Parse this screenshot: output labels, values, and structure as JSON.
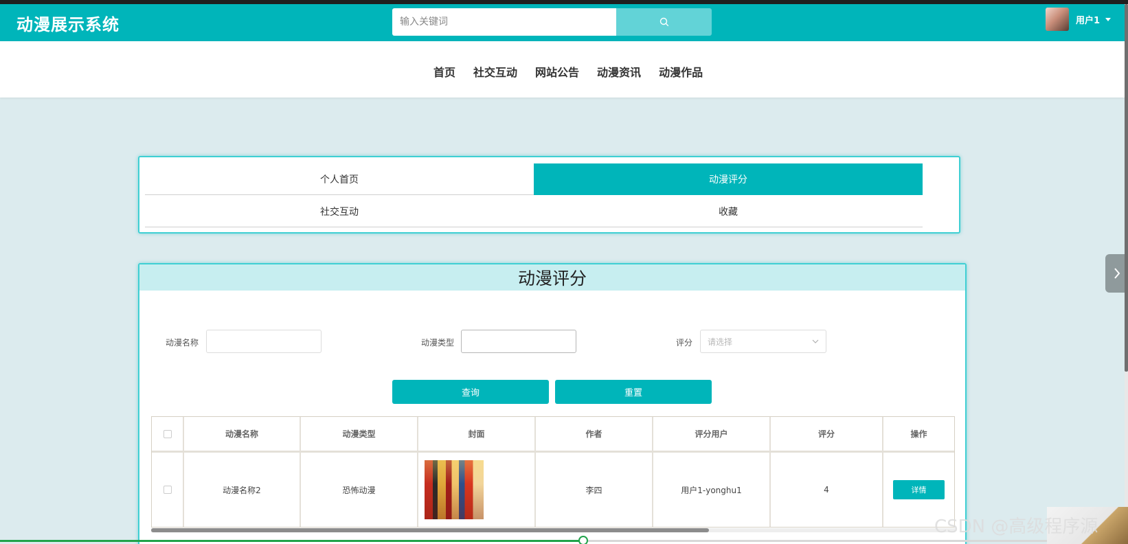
{
  "app": {
    "title": "动漫展示系统",
    "search_placeholder": "输入关键词",
    "username": "用户1"
  },
  "nav": {
    "items": [
      "首页",
      "社交互动",
      "网站公告",
      "动漫资讯",
      "动漫作品"
    ]
  },
  "tabs": {
    "items": [
      "个人首页",
      "动漫评分",
      "社交互动",
      "收藏"
    ],
    "active": "动漫评分"
  },
  "panel": {
    "title": "动漫评分",
    "filters": {
      "name_label": "动漫名称",
      "name_value": "",
      "type_label": "动漫类型",
      "type_value": "",
      "score_label": "评分",
      "score_placeholder": "请选择"
    },
    "buttons": {
      "query": "查询",
      "reset": "重置"
    }
  },
  "table": {
    "columns": [
      "动漫名称",
      "动漫类型",
      "封面",
      "作者",
      "评分用户",
      "评分",
      "操作"
    ],
    "rows": [
      {
        "name": "动漫名称2",
        "type": "恐怖动漫",
        "author": "李四",
        "rating_user": "用户1-yonghu1",
        "score": "4",
        "action": "详情"
      }
    ]
  },
  "watermark": "CSDN @高级程序源",
  "icons": {
    "search": "search-icon",
    "caret": "caret-down-icon",
    "chevron_down": "chevron-down-icon",
    "chevron_right": "chevron-right-icon"
  },
  "colors": {
    "primary": "#00b5ba",
    "title_bar": "#c7eef0",
    "background": "#dcebee"
  }
}
